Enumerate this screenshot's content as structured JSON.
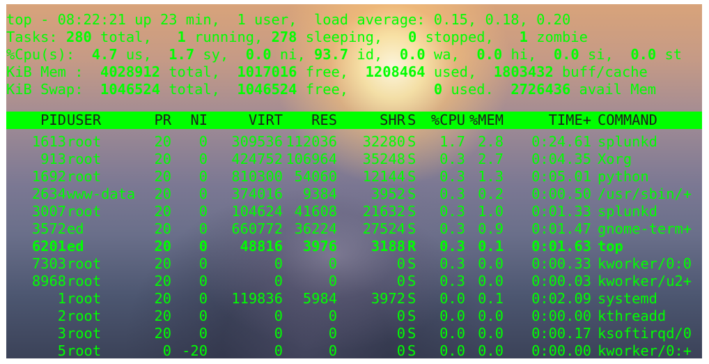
{
  "summary": {
    "line1": "top - 08:22:21 up 23 min,  1 user,  load average: 0.15, 0.18, 0.20",
    "tasks": {
      "label": "Tasks: ",
      "total": "280",
      "total_lbl": " total,   ",
      "running": "1",
      "running_lbl": " running, ",
      "sleeping": "278",
      "sleeping_lbl": " sleeping,   ",
      "stopped": "0",
      "stopped_lbl": " stopped,   ",
      "zombie": "1",
      "zombie_lbl": " zombie"
    },
    "cpu": {
      "label": "%Cpu(s):  ",
      "us": "4.7",
      "us_lbl": " us,  ",
      "sy": "1.7",
      "sy_lbl": " sy,  ",
      "ni": "0.0",
      "ni_lbl": " ni, ",
      "id": "93.7",
      "id_lbl": " id,  ",
      "wa": "0.0",
      "wa_lbl": " wa,  ",
      "hi": "0.0",
      "hi_lbl": " hi,  ",
      "si": "0.0",
      "si_lbl": " si,  ",
      "st": "0.0",
      "st_lbl": " st"
    },
    "mem": {
      "label": "KiB Mem :  ",
      "total": "4028912",
      "total_lbl": " total,  ",
      "free": "1017016",
      "free_lbl": " free,  ",
      "used": "1208464",
      "used_lbl": " used,  ",
      "buff": "1803432",
      "buff_lbl": " buff/cache"
    },
    "swap": {
      "label": "KiB Swap:  ",
      "total": "1046524",
      "total_lbl": " total,  ",
      "free": "1046524",
      "free_lbl": " free,          ",
      "used": "0",
      "used_lbl": " used.  ",
      "avail": "2726436",
      "avail_lbl": " avail Mem"
    }
  },
  "columns": [
    "PID",
    "USER",
    "PR",
    "NI",
    "VIRT",
    "RES",
    "SHR",
    "S",
    "%CPU",
    "%MEM",
    "TIME+",
    "COMMAND"
  ],
  "processes": [
    {
      "pid": "1613",
      "user": "root",
      "pr": "20",
      "ni": "0",
      "virt": "309536",
      "res": "112036",
      "shr": "32280",
      "s": "S",
      "cpu": "1.7",
      "mem": "2.8",
      "time": "0:24.61",
      "command": "splunkd"
    },
    {
      "pid": "913",
      "user": "root",
      "pr": "20",
      "ni": "0",
      "virt": "424752",
      "res": "106964",
      "shr": "35248",
      "s": "S",
      "cpu": "0.3",
      "mem": "2.7",
      "time": "0:04.35",
      "command": "Xorg"
    },
    {
      "pid": "1692",
      "user": "root",
      "pr": "20",
      "ni": "0",
      "virt": "810300",
      "res": "54060",
      "shr": "12144",
      "s": "S",
      "cpu": "0.3",
      "mem": "1.3",
      "time": "0:05.01",
      "command": "python"
    },
    {
      "pid": "2634",
      "user": "www-data",
      "pr": "20",
      "ni": "0",
      "virt": "374016",
      "res": "9384",
      "shr": "3952",
      "s": "S",
      "cpu": "0.3",
      "mem": "0.2",
      "time": "0:00.50",
      "command": "/usr/sbin/+"
    },
    {
      "pid": "3007",
      "user": "root",
      "pr": "20",
      "ni": "0",
      "virt": "104624",
      "res": "41608",
      "shr": "21632",
      "s": "S",
      "cpu": "0.3",
      "mem": "1.0",
      "time": "0:01.33",
      "command": "splunkd"
    },
    {
      "pid": "3572",
      "user": "ed",
      "pr": "20",
      "ni": "0",
      "virt": "660772",
      "res": "36224",
      "shr": "27524",
      "s": "S",
      "cpu": "0.3",
      "mem": "0.9",
      "time": "0:01.47",
      "command": "gnome-term+"
    },
    {
      "pid": "6201",
      "user": "ed",
      "pr": "20",
      "ni": "0",
      "virt": "48816",
      "res": "3976",
      "shr": "3188",
      "s": "R",
      "cpu": "0.3",
      "mem": "0.1",
      "time": "0:01.63",
      "command": "top"
    },
    {
      "pid": "7303",
      "user": "root",
      "pr": "20",
      "ni": "0",
      "virt": "0",
      "res": "0",
      "shr": "0",
      "s": "S",
      "cpu": "0.3",
      "mem": "0.0",
      "time": "0:00.33",
      "command": "kworker/0:0"
    },
    {
      "pid": "8968",
      "user": "root",
      "pr": "20",
      "ni": "0",
      "virt": "0",
      "res": "0",
      "shr": "0",
      "s": "S",
      "cpu": "0.3",
      "mem": "0.0",
      "time": "0:00.03",
      "command": "kworker/u2+"
    },
    {
      "pid": "1",
      "user": "root",
      "pr": "20",
      "ni": "0",
      "virt": "119836",
      "res": "5984",
      "shr": "3972",
      "s": "S",
      "cpu": "0.0",
      "mem": "0.1",
      "time": "0:02.09",
      "command": "systemd"
    },
    {
      "pid": "2",
      "user": "root",
      "pr": "20",
      "ni": "0",
      "virt": "0",
      "res": "0",
      "shr": "0",
      "s": "S",
      "cpu": "0.0",
      "mem": "0.0",
      "time": "0:00.00",
      "command": "kthreadd"
    },
    {
      "pid": "3",
      "user": "root",
      "pr": "20",
      "ni": "0",
      "virt": "0",
      "res": "0",
      "shr": "0",
      "s": "S",
      "cpu": "0.0",
      "mem": "0.0",
      "time": "0:00.17",
      "command": "ksoftirqd/0"
    },
    {
      "pid": "5",
      "user": "root",
      "pr": "0",
      "ni": "-20",
      "virt": "0",
      "res": "0",
      "shr": "0",
      "s": "S",
      "cpu": "0.0",
      "mem": "0.0",
      "time": "0:00.00",
      "command": "kworker/0:+"
    }
  ],
  "highlighted_pid": "6201",
  "colors": {
    "text": "#00ff00",
    "header_bg": "#00ff00",
    "header_text": "#1d1d1d"
  }
}
